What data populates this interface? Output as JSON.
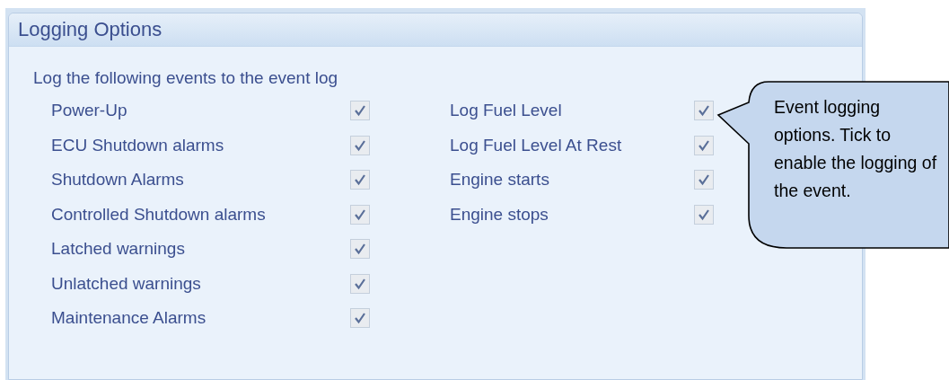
{
  "panel": {
    "title": "Logging Options",
    "intro": "Log the following events to the event log",
    "left_options": [
      {
        "label": "Power-Up",
        "checked": true
      },
      {
        "label": "ECU Shutdown alarms",
        "checked": true
      },
      {
        "label": "Shutdown Alarms",
        "checked": true
      },
      {
        "label": "Controlled Shutdown alarms",
        "checked": true
      },
      {
        "label": "Latched warnings",
        "checked": true
      },
      {
        "label": "Unlatched warnings",
        "checked": true
      },
      {
        "label": "Maintenance Alarms",
        "checked": true
      }
    ],
    "right_options": [
      {
        "label": "Log Fuel Level",
        "checked": true
      },
      {
        "label": "Log Fuel Level At Rest",
        "checked": true
      },
      {
        "label": "Engine starts",
        "checked": true
      },
      {
        "label": "Engine stops",
        "checked": true
      }
    ]
  },
  "callout": {
    "text": "Event logging options. Tick to enable the logging of the event."
  }
}
